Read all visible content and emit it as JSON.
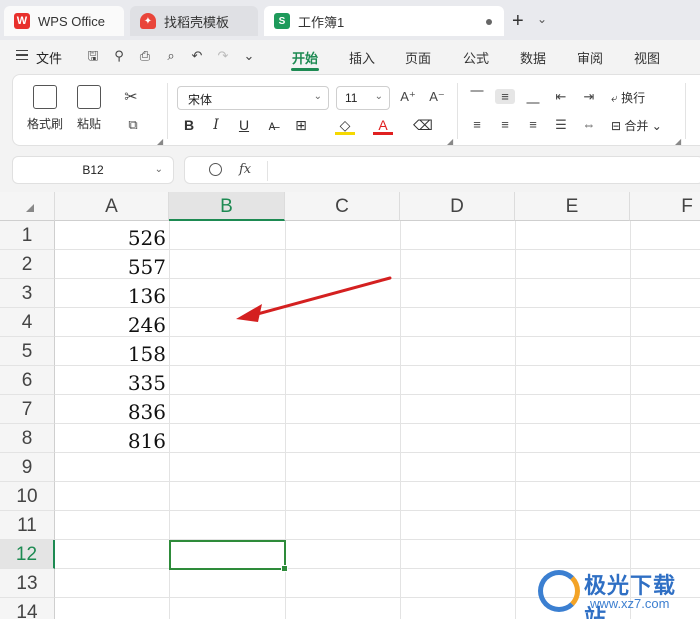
{
  "tabs": [
    {
      "label": "WPS Office",
      "icon": "wps-logo-icon"
    },
    {
      "label": "找稻壳模板",
      "icon": "docer-icon"
    },
    {
      "label": "工作簿1",
      "icon": "spreadsheet-icon",
      "icon_letter": "S"
    }
  ],
  "new_tab": "+",
  "menu": {
    "file": "文件",
    "tabs": [
      "开始",
      "插入",
      "页面",
      "公式",
      "数据",
      "审阅",
      "视图"
    ],
    "active": "开始"
  },
  "ribbon": {
    "format_painter": "格式刷",
    "paste": "粘贴",
    "font_name": "宋体",
    "font_size": "11",
    "wrap": "换行",
    "merge": "合并",
    "bold": "B",
    "italic": "I",
    "underline": "U",
    "font_color_letter": "A",
    "font_color": "#e02020",
    "highlight_color": "#f5d800",
    "grow_font": "A⁺",
    "shrink_font": "A⁻"
  },
  "formula_bar": {
    "name_box": "B12",
    "fx": "fx",
    "formula": ""
  },
  "sheet": {
    "columns": [
      "A",
      "B",
      "C",
      "D",
      "E",
      "F"
    ],
    "selected_column": "B",
    "rows": [
      "1",
      "2",
      "3",
      "4",
      "5",
      "6",
      "7",
      "8",
      "9",
      "10",
      "11",
      "12",
      "13",
      "14"
    ],
    "selected_row": "12",
    "column_a_values": [
      "526",
      "557",
      "136",
      "246",
      "158",
      "335",
      "836",
      "816"
    ],
    "active_cell": "B12",
    "accent": "#1d8a52",
    "arrow_color": "#d42020"
  },
  "watermark": {
    "title": "极光下载站",
    "url": "www.xz7.com"
  }
}
